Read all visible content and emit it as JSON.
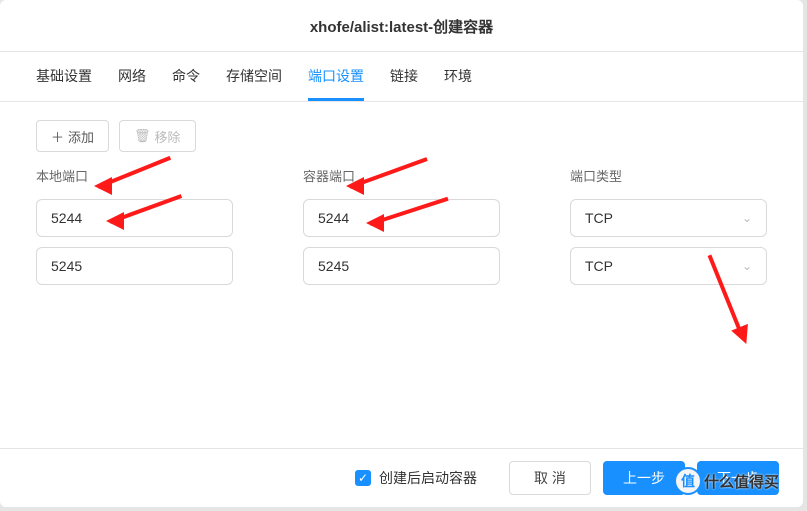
{
  "header": {
    "title": "xhofe/alist:latest-创建容器"
  },
  "tabs": [
    {
      "label": "基础设置",
      "active": false
    },
    {
      "label": "网络",
      "active": false
    },
    {
      "label": "命令",
      "active": false
    },
    {
      "label": "存储空间",
      "active": false
    },
    {
      "label": "端口设置",
      "active": true
    },
    {
      "label": "链接",
      "active": false
    },
    {
      "label": "环境",
      "active": false
    }
  ],
  "toolbar": {
    "add_icon": "＋",
    "add_label": "添加",
    "del_icon": "🗑",
    "del_label": "移除"
  },
  "columns": {
    "local": "本地端口",
    "container": "容器端口",
    "type": "端口类型"
  },
  "rows": [
    {
      "local": "5244",
      "container": "5244",
      "type": "TCP"
    },
    {
      "local": "5245",
      "container": "5245",
      "type": "TCP"
    }
  ],
  "footer": {
    "checkbox_checked": true,
    "checkbox_label": "创建后启动容器",
    "cancel": "取 消",
    "prev": "上一步",
    "next": "下一步"
  },
  "watermark": {
    "badge": "值",
    "text": "什么值得买"
  }
}
